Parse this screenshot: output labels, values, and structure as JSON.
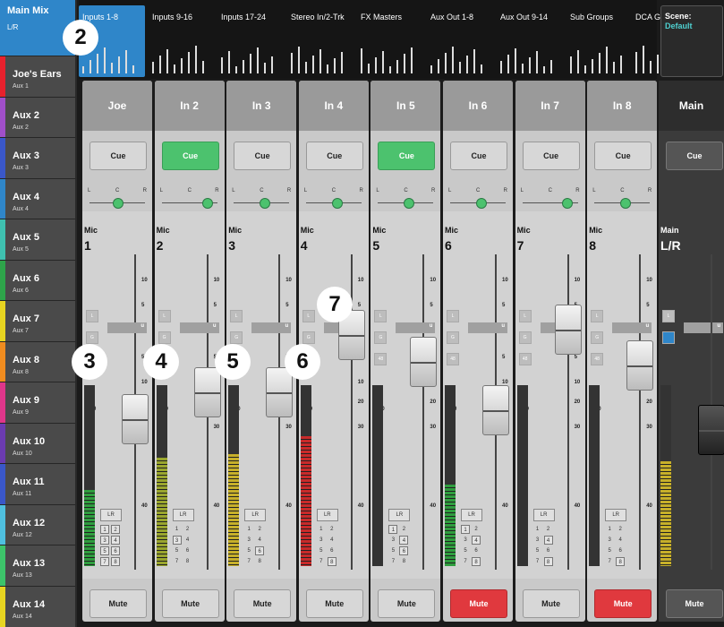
{
  "sidebar": {
    "main_mix": {
      "title": "Main Mix",
      "sub": "L/R"
    },
    "items": [
      {
        "title": "Joe's Ears",
        "sub": "Aux 1",
        "color": "#e8212d"
      },
      {
        "title": "Aux 2",
        "sub": "Aux 2",
        "color": "#a04fc9"
      },
      {
        "title": "Aux 3",
        "sub": "Aux 3",
        "color": "#3a57c9"
      },
      {
        "title": "Aux 4",
        "sub": "Aux 4",
        "color": "#2f86c9"
      },
      {
        "title": "Aux 5",
        "sub": "Aux 5",
        "color": "#3fc1b0"
      },
      {
        "title": "Aux 6",
        "sub": "Aux 6",
        "color": "#2ea44a"
      },
      {
        "title": "Aux 7",
        "sub": "Aux 7",
        "color": "#e8d521"
      },
      {
        "title": "Aux 8",
        "sub": "Aux 8",
        "color": "#f08c1f"
      },
      {
        "title": "Aux 9",
        "sub": "Aux 9",
        "color": "#e0368a"
      },
      {
        "title": "Aux 10",
        "sub": "Aux 10",
        "color": "#6b3bb0"
      },
      {
        "title": "Aux 11",
        "sub": "Aux 11",
        "color": "#3a57c9"
      },
      {
        "title": "Aux 12",
        "sub": "Aux 12",
        "color": "#4fc0e0"
      },
      {
        "title": "Aux 13",
        "sub": "Aux 13",
        "color": "#3dc46a"
      },
      {
        "title": "Aux 14",
        "sub": "Aux 14",
        "color": "#e8d521"
      }
    ]
  },
  "tabs": [
    {
      "label": "Inputs 1-8",
      "active": true
    },
    {
      "label": "Inputs 9-16",
      "active": false
    },
    {
      "label": "Inputs 17-24",
      "active": false
    },
    {
      "label": "Stereo In/2-Trk",
      "active": false
    },
    {
      "label": "FX Masters",
      "active": false
    },
    {
      "label": "Aux Out 1-8",
      "active": false
    },
    {
      "label": "Aux Out 9-14",
      "active": false
    },
    {
      "label": "Sub Groups",
      "active": false
    },
    {
      "label": "DCA Groups",
      "active": false
    }
  ],
  "scene": {
    "label": "Scene:",
    "value": "Default"
  },
  "channels": [
    {
      "name": "Joe",
      "type": "Mic",
      "num": "1",
      "cue": false,
      "mute": false,
      "pan": 0.5,
      "fader_db": "0",
      "meter": 0.42,
      "meter_color": "#2f9e3f",
      "assign_boxed": [
        1,
        2,
        3,
        4,
        5,
        6,
        7,
        8
      ]
    },
    {
      "name": "In 2",
      "type": "Mic",
      "num": "2",
      "cue": true,
      "mute": false,
      "pan": 0.82,
      "fader_db": "5",
      "meter": 0.6,
      "meter_color": "#9aa62e",
      "assign_boxed": [
        3
      ]
    },
    {
      "name": "In 3",
      "type": "Mic",
      "num": "3",
      "cue": false,
      "mute": false,
      "pan": 0.55,
      "fader_db": "5",
      "meter": 0.62,
      "meter_color": "#c7b02a",
      "assign_boxed": [
        6
      ]
    },
    {
      "name": "In 4",
      "type": "Mic",
      "num": "4",
      "cue": false,
      "mute": false,
      "pan": 0.55,
      "fader_db": "u",
      "meter": 0.72,
      "meter_color": "#c92a2a",
      "assign_boxed": [
        8
      ]
    },
    {
      "name": "In 5",
      "type": "Mic",
      "num": "5",
      "cue": true,
      "mute": false,
      "pan": 0.55,
      "fader_db": "10",
      "meter": 0.0,
      "meter_color": "#2f9e3f",
      "assign_boxed": [
        1,
        4,
        6
      ]
    },
    {
      "name": "In 6",
      "type": "Mic",
      "num": "6",
      "cue": false,
      "mute": true,
      "pan": 0.55,
      "fader_db": "0",
      "meter": 0.45,
      "meter_color": "#2f9e3f",
      "assign_boxed": [
        1,
        4,
        8
      ]
    },
    {
      "name": "In 7",
      "type": "Mic",
      "num": "7",
      "cue": false,
      "mute": false,
      "pan": 0.8,
      "fader_db": "5",
      "meter": 0.0,
      "meter_color": "#2f9e3f",
      "assign_boxed": [
        4,
        8
      ]
    },
    {
      "name": "In 8",
      "type": "Mic",
      "num": "8",
      "cue": false,
      "mute": true,
      "pan": 0.55,
      "fader_db": "10",
      "meter": 0.0,
      "meter_color": "#2f9e3f",
      "assign_boxed": [
        8
      ]
    }
  ],
  "main": {
    "name": "Main",
    "cue_label": "Cue",
    "type": "Main",
    "num": "L/R",
    "mute_label": "Mute",
    "meter": 0.58,
    "meter_color": "#c7b02a"
  },
  "labels": {
    "cue": "Cue",
    "mute": "Mute",
    "pan_l": "L",
    "pan_c": "C",
    "pan_r": "R",
    "lr": "LR",
    "unity": "u"
  },
  "fader_scale": [
    "10",
    "5",
    "u",
    "5",
    "10",
    "20",
    "30",
    "40"
  ],
  "callouts": [
    "2",
    "3",
    "4",
    "5",
    "6",
    "7"
  ]
}
